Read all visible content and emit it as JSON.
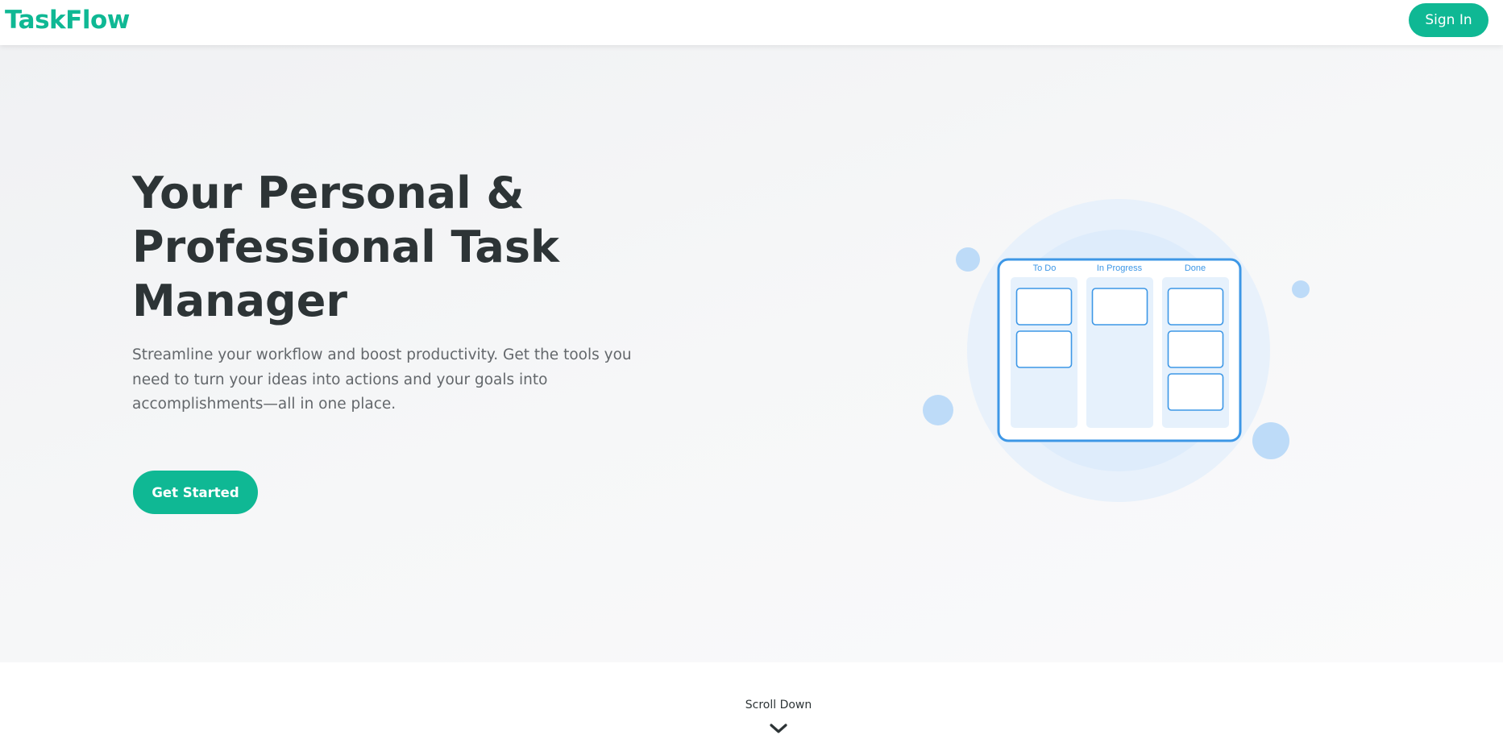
{
  "header": {
    "logo": "TaskFlow",
    "sign_in_label": "Sign In"
  },
  "hero": {
    "headline_lines": [
      "Your Personal &",
      "Professional Task",
      "Manager"
    ],
    "subtitle_lines": [
      "Streamline your workflow and boost productivity. Get the tools you",
      "need to turn your ideas into actions and your goals into",
      "accomplishments—all in one place."
    ],
    "cta_label": "Get Started"
  },
  "illustration": {
    "columns": [
      {
        "title": "To Do",
        "cards": 2
      },
      {
        "title": "In Progress",
        "cards": 1
      },
      {
        "title": "Done",
        "cards": 3
      }
    ]
  },
  "scroll": {
    "label": "Scroll Down",
    "icon": "chevron-down-icon"
  },
  "colors": {
    "brand": "#0fb894",
    "text": "#2d3436",
    "muted": "#63676b",
    "illustration_blue": "#3d97e6"
  }
}
